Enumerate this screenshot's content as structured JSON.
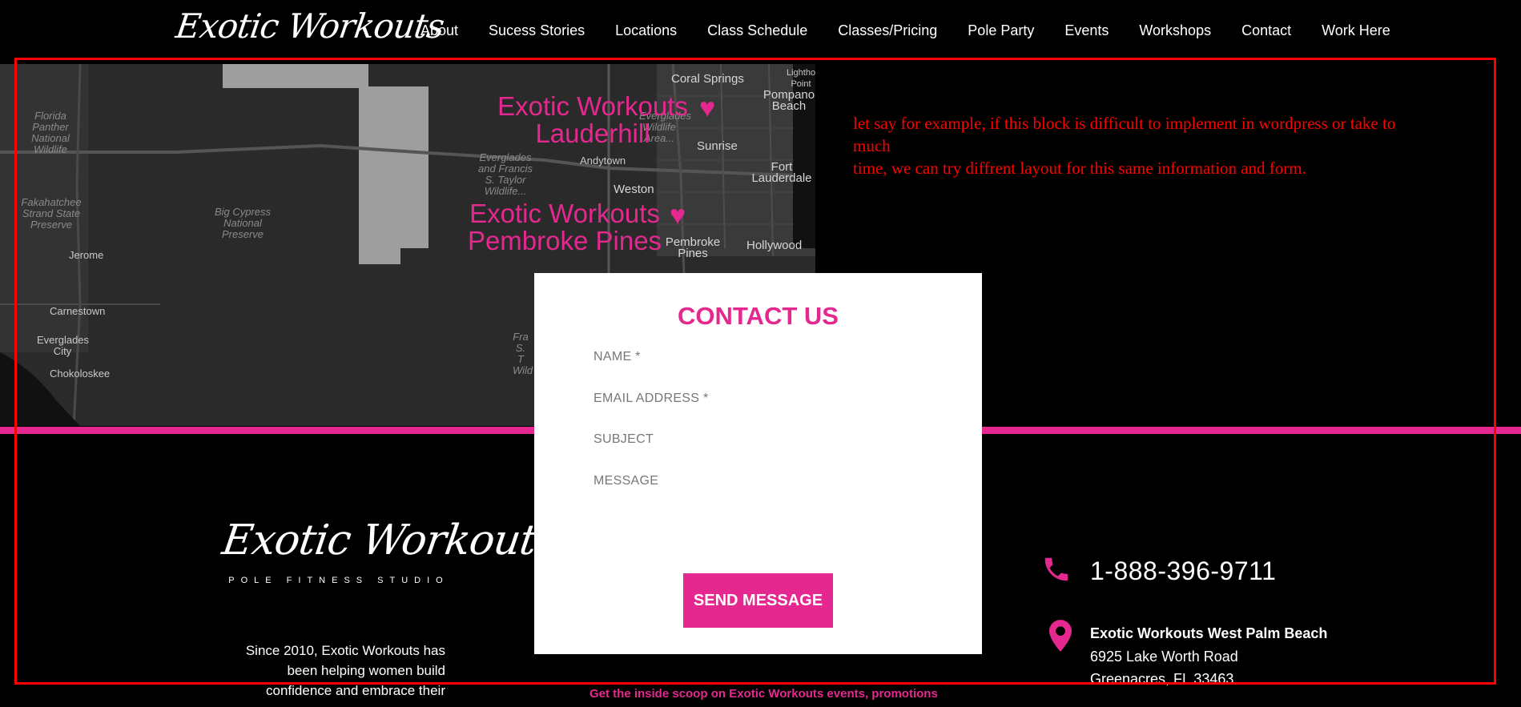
{
  "header": {
    "logo": "Exotic Workouts",
    "nav": [
      "About",
      "Sucess Stories",
      "Locations",
      "Class Schedule",
      "Classes/Pricing",
      "Pole Party",
      "Events",
      "Workshops",
      "Contact",
      "Work Here"
    ]
  },
  "map": {
    "labels": {
      "florida_panther": "Florida Panther National Wildlife",
      "fakahatchee": "Fakahatchee Strand State Preserve",
      "big_cypress": "Big Cypress National Preserve",
      "jerome": "Jerome",
      "carnestown": "Carnestown",
      "everglades_city": "Everglades City",
      "chokoloskee": "Chokoloskee",
      "everglades_francis": "Everglades and Francis S. Taylor Wildlife...",
      "everglades_wildlife": "Everglades Wildlife Area...",
      "andytown": "Andytown",
      "weston": "Weston",
      "sunrise": "Sunrise",
      "fort_lauderdale": "Fort Lauderdale",
      "pembroke_pines": "Pembroke Pines",
      "hollywood": "Hollywood",
      "coral_springs": "Coral Springs",
      "pompano_beach": "Pompano Beach",
      "lighthouse_point": "Lighthouse Point",
      "fra": "Fra S. T Wild"
    },
    "pins": {
      "lauderhill_line1": "Exotic Workouts",
      "lauderhill_line2": "Lauderhill",
      "pembroke_line1": "Exotic Workouts",
      "pembroke_line2": "Pembroke Pines"
    }
  },
  "note": {
    "line1": "let say for example, if this block is difficult to implement in wordpress or take to much",
    "line2": "time, we can try diffrent layout for this same information and form."
  },
  "contact_form": {
    "title": "CONTACT US",
    "name_placeholder": "NAME *",
    "email_placeholder": "EMAIL ADDRESS *",
    "subject_placeholder": "SUBJECT",
    "message_placeholder": "MESSAGE",
    "send_label": "SEND MESSAGE"
  },
  "footer": {
    "logo_script": "Exotic Workouts",
    "logo_tagline": "POLE FITNESS STUDIO",
    "about_text": "Since 2010, Exotic Workouts has been helping women build confidence and embrace their",
    "phone": "1-888-396-9711",
    "address_name": "Exotic Workouts West Palm Beach",
    "address_line1": "6925 Lake Worth Road",
    "address_line2": "Greenacres, FL 33463",
    "scoop": "Get the inside scoop on Exotic Workouts events, promotions"
  },
  "colors": {
    "accent": "#e5288f",
    "annotation": "#ff0000",
    "background": "#000000"
  }
}
